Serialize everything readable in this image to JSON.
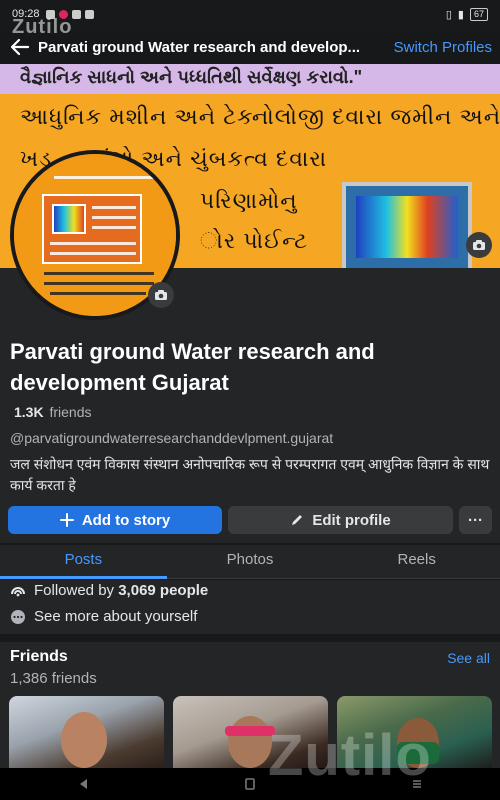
{
  "status_bar": {
    "time": "09:28",
    "battery": "67"
  },
  "watermark": {
    "top": "Zutilo",
    "bottom": "Zutilo"
  },
  "header": {
    "title": "Parvati ground Water research and develop...",
    "switch_profiles": "Switch Profiles"
  },
  "cover": {
    "strip_text": "વૈજ્ઞાનિક સાધનો અને પધ્ધતિથી સર્વેક્ષણ કરાવો.\"",
    "line1": "આધુનિક મશીન અને ટેક્નોલોજી દવારા જમીન અને",
    "line2": "ખડ       ન  તરંગો  અને  ચુંબકત્વ  દવારા",
    "line3": "પરિણામોનુ",
    "line4": "ોર  પોઈન્ટ"
  },
  "profile": {
    "name": "Parvati ground Water research and development Gujarat",
    "friends_count": "1.3K",
    "friends_label": "friends",
    "username": "@parvatigroundwaterresearchanddevlpment.gujarat",
    "bio": "जल संशोधन एवंम विकास संस्थान अनोपचारिक रूप से परम्परागत एवम् आधुनिक विज्ञान के साथ कार्य करता हे"
  },
  "buttons": {
    "add_to_story": "Add to story",
    "edit_profile": "Edit profile",
    "more": "···"
  },
  "tabs": [
    {
      "label": "Posts"
    },
    {
      "label": "Photos"
    },
    {
      "label": "Reels"
    }
  ],
  "about": {
    "followed_prefix": "Followed by",
    "followers": "3,069 people",
    "see_more": "See more about yourself"
  },
  "friends": {
    "title": "Friends",
    "see_all": "See all",
    "count": "1,386 friends"
  },
  "colors": {
    "accent": "#2374e1",
    "link": "#4599ff",
    "background": "#18191a",
    "surface": "#242526"
  },
  "icons": [
    "back-arrow-icon",
    "camera-icon",
    "plus-icon",
    "pencil-icon",
    "more-icon",
    "followers-icon",
    "more-info-icon",
    "back-key-icon",
    "home-key-icon",
    "recents-key-icon"
  ]
}
